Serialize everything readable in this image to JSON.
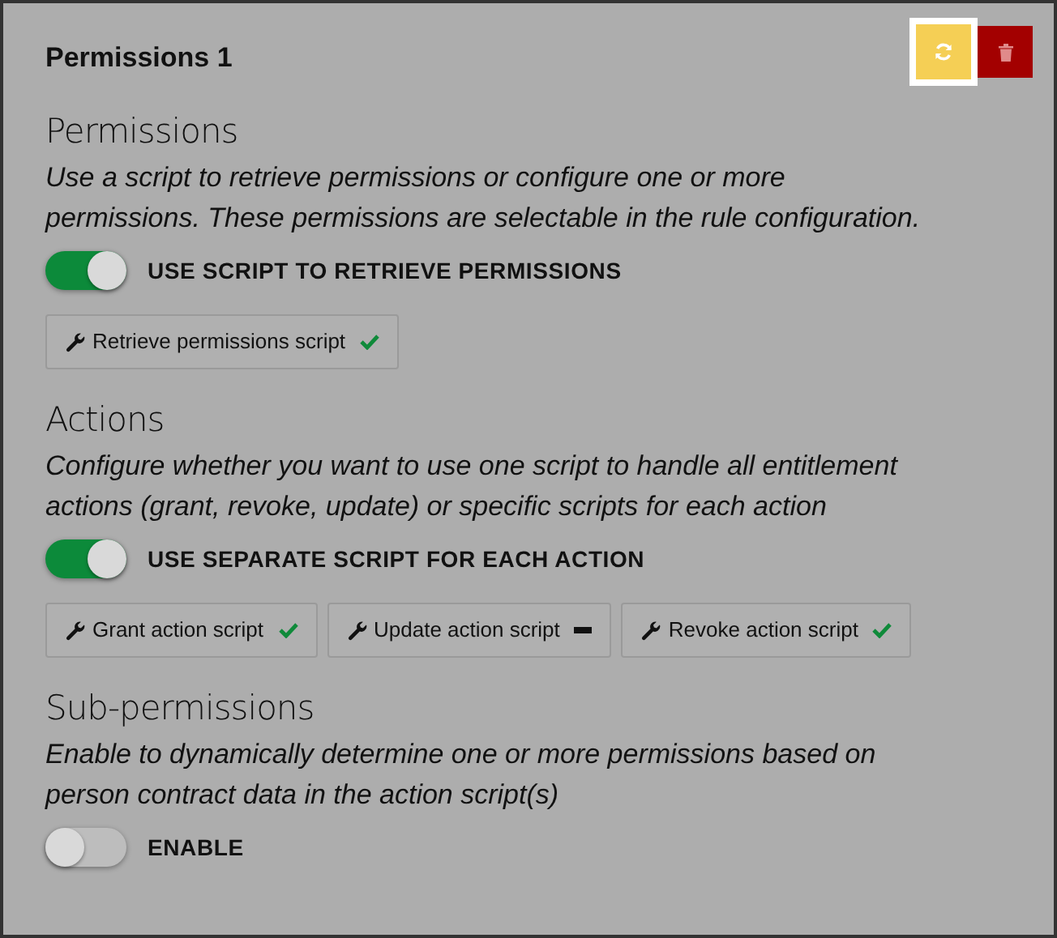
{
  "card": {
    "title": "Permissions 1",
    "refresh_focused": true
  },
  "sections": [
    {
      "title": "Permissions",
      "description": "Use a script to retrieve permissions or configure one or more permissions. These permissions are selectable in the rule configuration.",
      "toggle": {
        "label": "USE SCRIPT TO RETRIEVE PERMISSIONS",
        "on": true
      },
      "scripts": [
        {
          "label": "Retrieve permissions script",
          "configured": true
        }
      ]
    },
    {
      "title": "Actions",
      "description": "Configure whether you want to use one script to handle all entitlement actions (grant, revoke, update) or specific scripts for each action",
      "toggle": {
        "label": "USE SEPARATE SCRIPT FOR EACH ACTION",
        "on": true
      },
      "scripts": [
        {
          "label": "Grant action script",
          "configured": true
        },
        {
          "label": "Update action script",
          "configured": false
        },
        {
          "label": "Revoke action script",
          "configured": true
        }
      ]
    },
    {
      "title": "Sub-permissions",
      "description": "Enable to dynamically determine one or more permissions based on person contract data in the action script(s)",
      "toggle": {
        "label": "ENABLE",
        "on": false
      }
    }
  ]
}
